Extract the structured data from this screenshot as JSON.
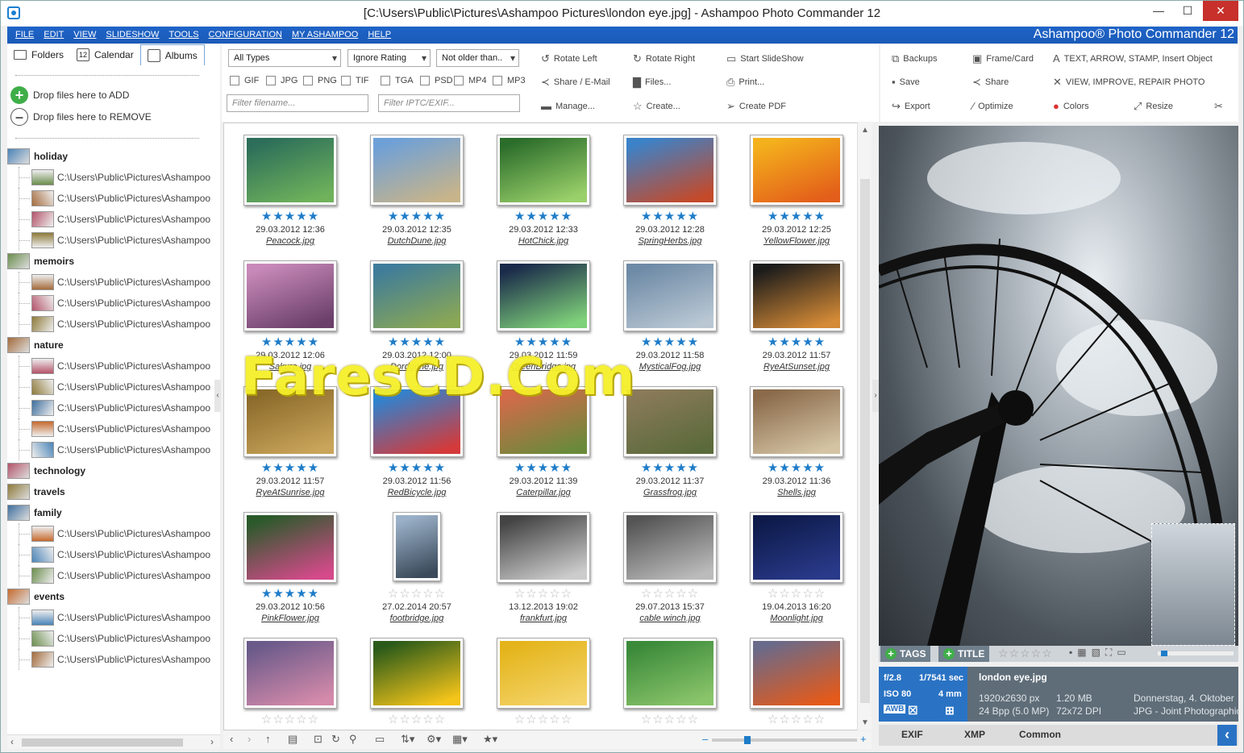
{
  "window": {
    "title": "[C:\\Users\\Public\\Pictures\\Ashampoo Pictures\\london eye.jpg] - Ashampoo Photo Commander 12",
    "minimize": "—",
    "maximize": "☐",
    "close": "✕"
  },
  "menu": {
    "items": [
      "FILE",
      "EDIT",
      "VIEW",
      "SLIDESHOW",
      "TOOLS",
      "CONFIGURATION",
      "MY ASHAMPOO",
      "HELP"
    ],
    "brand": "Ashampoo® Photo Commander 12"
  },
  "left": {
    "tabs": [
      "Folders",
      "Calendar",
      "Albums"
    ],
    "drop_add": "Drop files here to ADD",
    "drop_remove": "Drop files here to REMOVE",
    "path": "C:\\Users\\Public\\Pictures\\Ashampoo",
    "albums": [
      {
        "name": "holiday",
        "count": 4
      },
      {
        "name": "memoirs",
        "count": 3
      },
      {
        "name": "nature",
        "count": 5
      },
      {
        "name": "technology",
        "count": 0
      },
      {
        "name": "travels",
        "count": 0
      },
      {
        "name": "family",
        "count": 3
      },
      {
        "name": "events",
        "count": 3
      }
    ]
  },
  "toolbar": {
    "type_select": "All Types",
    "rating_select": "Ignore Rating",
    "age_select": "Not older than..",
    "checks": [
      "GIF",
      "JPG",
      "PNG",
      "TIF",
      "TGA",
      "PSD",
      "MP4",
      "MP3"
    ],
    "filter_name": "Filter filename...",
    "filter_iptc": "Filter IPTC/EXIF...",
    "rotate_left": "Rotate Left",
    "rotate_right": "Rotate Right",
    "start_slideshow": "Start SlideShow",
    "share_email": "Share / E-Mail",
    "files": "Files...",
    "print": "Print...",
    "manage": "Manage...",
    "create": "Create...",
    "create_pdf": "Create PDF",
    "backups": "Backups",
    "frame_card": "Frame/Card",
    "text_objects": "TEXT, ARROW, STAMP, Insert Object",
    "save": "Save",
    "share": "Share",
    "view_improve": "VIEW, IMPROVE, REPAIR PHOTO",
    "export": "Export",
    "optimize": "Optimize",
    "colors": "Colors",
    "resize": "Resize"
  },
  "photos": [
    {
      "date": "29.03.2012 12:36",
      "name": "Peacock.jpg",
      "rated": true
    },
    {
      "date": "29.03.2012 12:35",
      "name": "DutchDune.jpg",
      "rated": true
    },
    {
      "date": "29.03.2012 12:33",
      "name": "HotChick.jpg",
      "rated": true
    },
    {
      "date": "29.03.2012 12:28",
      "name": "SpringHerbs.jpg",
      "rated": true
    },
    {
      "date": "29.03.2012 12:25",
      "name": "YellowFlower.jpg",
      "rated": true
    },
    {
      "date": "29.03.2012 12:06",
      "name": "Sakura.jpg",
      "rated": true
    },
    {
      "date": "29.03.2012 12:00",
      "name": "Dordogne.jpg",
      "rated": true
    },
    {
      "date": "29.03.2012 11:59",
      "name": "GreenBridge.jpg",
      "rated": true
    },
    {
      "date": "29.03.2012 11:58",
      "name": "MysticalFog.jpg",
      "rated": true
    },
    {
      "date": "29.03.2012 11:57",
      "name": "RyeAtSunset.jpg",
      "rated": true
    },
    {
      "date": "29.03.2012 11:57",
      "name": "RyeAtSunrise.jpg",
      "rated": true
    },
    {
      "date": "29.03.2012 11:56",
      "name": "RedBicycle.jpg",
      "rated": true
    },
    {
      "date": "29.03.2012 11:39",
      "name": "Caterpillar.jpg",
      "rated": true
    },
    {
      "date": "29.03.2012 11:37",
      "name": "Grassfrog.jpg",
      "rated": true
    },
    {
      "date": "29.03.2012 11:36",
      "name": "Shells.jpg",
      "rated": true
    },
    {
      "date": "29.03.2012 10:56",
      "name": "PinkFlower.jpg",
      "rated": true
    },
    {
      "date": "27.02.2014 20:57",
      "name": "footbridge.jpg",
      "rated": false
    },
    {
      "date": "13.12.2013 19:02",
      "name": "frankfurt.jpg",
      "rated": false
    },
    {
      "date": "29.07.2013 15:37",
      "name": "cable winch.jpg",
      "rated": false
    },
    {
      "date": "19.04.2013 16:20",
      "name": "Moonlight.jpg",
      "rated": false
    },
    {
      "date": "",
      "name": "",
      "rated": false
    },
    {
      "date": "",
      "name": "",
      "rated": false
    },
    {
      "date": "",
      "name": "",
      "rated": false
    },
    {
      "date": "",
      "name": "",
      "rated": false
    },
    {
      "date": "",
      "name": "",
      "rated": false
    }
  ],
  "preview": {
    "tags_label": "TAGS",
    "title_label": "TITLE",
    "exif": {
      "aperture": "f/2.8",
      "shutter": "1/7541 sec",
      "iso": "ISO 80",
      "focal": "4 mm",
      "awb": "AWB"
    },
    "file": "london eye.jpg",
    "dims": "1920x2630 px",
    "bpp": "24 Bpp (5.0 MP)",
    "size": "1.20 MB",
    "dpi": "72x72 DPI",
    "date": "Donnerstag, 4. Oktober",
    "format": "JPG - Joint Photographic",
    "tabs": [
      "EXIF",
      "XMP",
      "Common"
    ]
  },
  "watermark": "FaresCD.Com",
  "colors": {
    "accent": "#1e63c8",
    "star": "#1e7cc8",
    "add": "#3fae49"
  }
}
